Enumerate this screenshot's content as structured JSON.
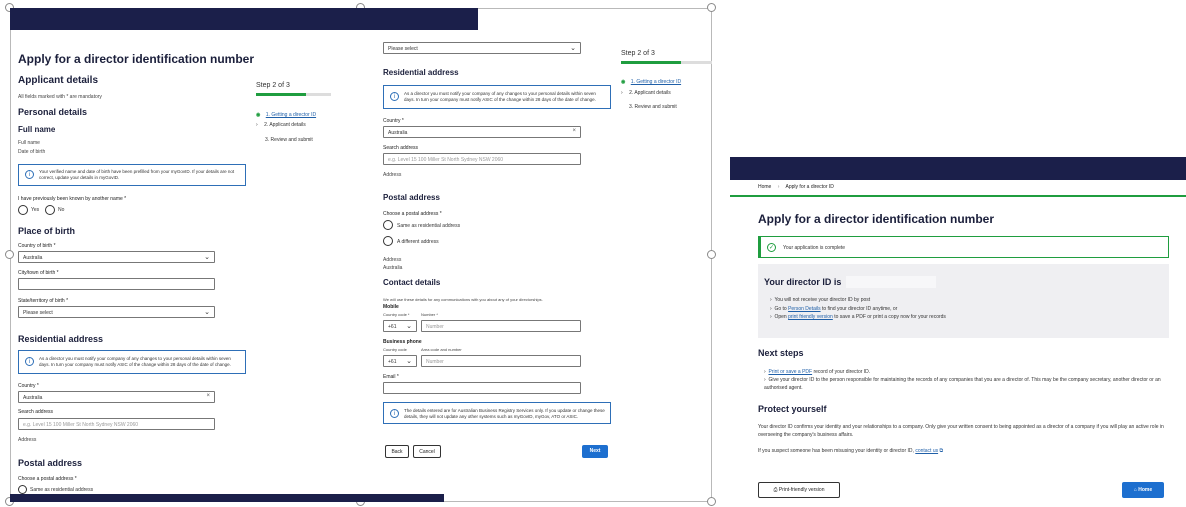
{
  "left_panel": {
    "title": "Apply for a director identification number",
    "section_heading": "Applicant details",
    "mandatory_note": "All fields marked with * are mandatory",
    "personal_details": "Personal details",
    "full_name_heading": "Full name",
    "full_name_label": "Full name",
    "dob_label": "Date of birth",
    "verified_notice": "Your verified name and date of birth have been prefilled from your myGovID. If your details are not correct, update your details in myGovID.",
    "known_by_question": "I have previously been known by another name *",
    "yes": "Yes",
    "no": "No",
    "place_of_birth": "Place of birth",
    "country_of_birth_label": "Country of birth *",
    "country_of_birth_value": "Australia",
    "city_label": "City/town of birth *",
    "state_label": "State/territory of birth *",
    "state_value": "Please select",
    "residential_heading": "Residential address",
    "residential_notice": "As a director you must notify your company of any changes to your personal details within seven days. In turn your company must notify ASIC of the change within 28 days of the date of change.",
    "country_label": "Country *",
    "country_value": "Australia",
    "search_label": "Search address",
    "search_placeholder": "e.g. Level 15 100 Miller St North Sydney NSW 2060",
    "address_label": "Address",
    "postal_heading": "Postal address",
    "choose_postal_label": "Choose a postal address *",
    "same_as_res": "Same as residential address"
  },
  "left_steps": {
    "title": "Step 2 of 3",
    "progress": 0.66,
    "step1": "1. Getting a director ID",
    "step2": "2. Applicant details",
    "step3": "3. Review and submit"
  },
  "middle_panel": {
    "top_select": "Please select",
    "residential_heading": "Residential address",
    "residential_notice": "As a director you must notify your company of any changes to your personal details within seven days. In turn your company must notify ASIC of the change within 28 days of the date of change.",
    "country_label": "Country *",
    "country_value": "Australia",
    "search_label": "Search address",
    "search_placeholder": "e.g. Level 15 100 Miller St North Sydney NSW 2060",
    "address_label": "Address",
    "postal_heading": "Postal address",
    "choose_postal_label": "Choose a postal address *",
    "same_as_res": "Same as residential address",
    "different_address": "A different address",
    "address2_label": "Address",
    "address2_value": "Australia",
    "contact_heading": "Contact details",
    "contact_note": "We will use these details for any communications with you about any of your directorships.",
    "mobile_label": "Mobile",
    "country_code_label": "Country code *",
    "number_label": "Number *",
    "country_code_value": "+61",
    "number_placeholder": "Number",
    "business_phone_label": "Business phone",
    "country_code_label2": "Country code",
    "area_code_label": "Area code and number",
    "country_code_value2": "+61",
    "number_placeholder2": "Number",
    "email_label": "Email *",
    "bottom_notice": "The details entered are for Australian Business Registry Services only. If you update or change these details, they will not update any other systems such as myGovID, myGov, ATO or ASIC.",
    "back_btn": "Back",
    "cancel_btn": "Cancel",
    "next_btn": "Next"
  },
  "middle_steps": {
    "title": "Step 2 of 3",
    "progress": 0.66,
    "step1": "1. Getting a director ID",
    "step2": "2. Applicant details",
    "step3": "3. Review and submit"
  },
  "right_panel": {
    "breadcrumb_home": "Home",
    "breadcrumb_current": "Apply for a director ID",
    "title": "Apply for a director identification number",
    "success_msg": "Your application is complete",
    "director_id_heading": "Your director ID is",
    "bullet1": "You will not receive your director ID by post",
    "bullet2_pre": "Go to ",
    "bullet2_link": "Person Details",
    "bullet2_post": " to find your director ID anytime, or",
    "bullet3_pre": "Open ",
    "bullet3_link": "print friendly version",
    "bullet3_post": " to save a PDF or print a copy now for your records",
    "next_steps_heading": "Next steps",
    "ns1_link": "Print or save a PDF",
    "ns1_post": " record of your director ID.",
    "ns2": "Give your director ID to the person responsible for maintaining the records of any companies that you are a director of. This may be the company secretary, another director or an authorised agent.",
    "protect_heading": "Protect yourself",
    "protect_text": "Your director ID confirms your identity and your relationships to a company. Only give your written consent to being appointed as a director of a company if you will play an active role in overseeing the company's business affairs.",
    "suspect_pre": "If you suspect someone has been misusing your identity or director ID, ",
    "suspect_link": "contact us",
    "print_btn": "Print-friendly version",
    "home_btn": "Home"
  },
  "colors": {
    "navy": "#1b1f4a",
    "accent_green": "#1f9d3f",
    "primary_blue": "#1d6fcf",
    "notice_blue": "#2e6fb7"
  }
}
